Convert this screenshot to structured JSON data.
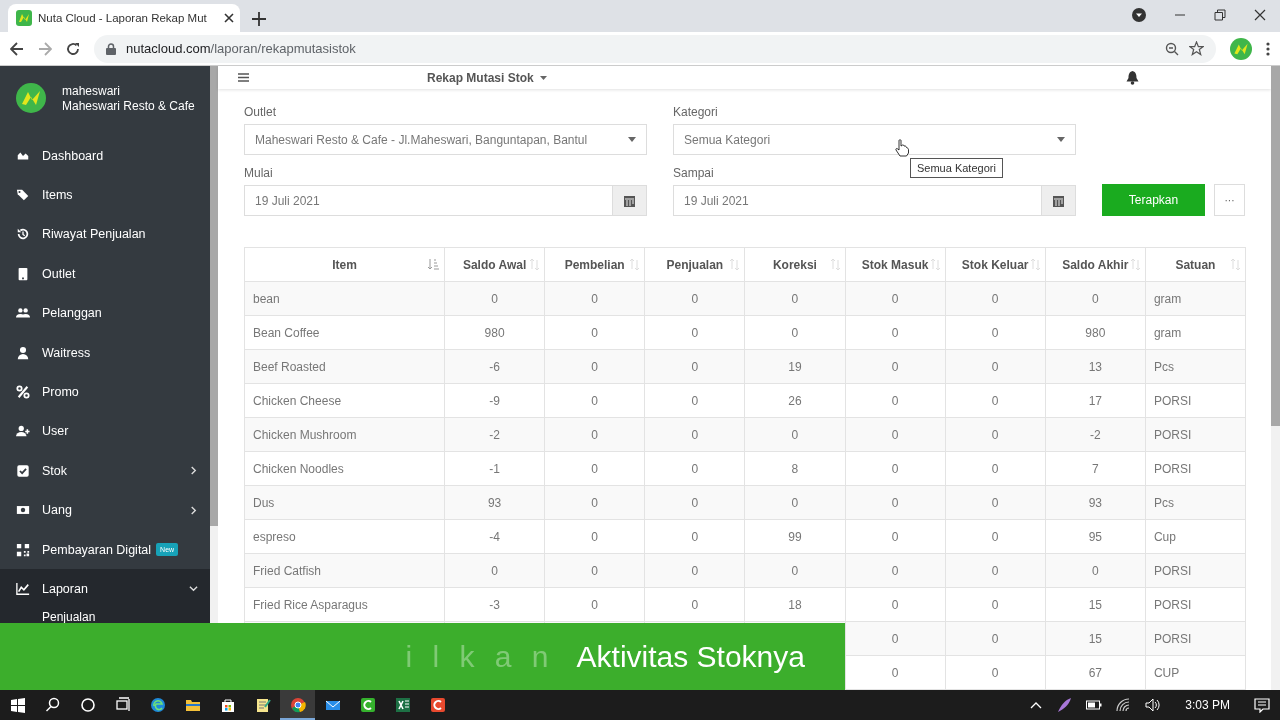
{
  "browser": {
    "tab_title": "Nuta Cloud - Laporan Rekap Mut",
    "url_domain": "nutacloud.com",
    "url_path": "/laporan/rekapmutasistok"
  },
  "sidebar": {
    "user": "maheswari",
    "store": "Maheswari Resto & Cafe",
    "items": [
      {
        "label": "Dashboard",
        "kind": "link",
        "expanded": false,
        "selected": false
      },
      {
        "label": "Items",
        "kind": "link",
        "expanded": false,
        "selected": false
      },
      {
        "label": "Riwayat Penjualan",
        "kind": "link",
        "expanded": false,
        "selected": false
      },
      {
        "label": "Outlet",
        "kind": "link",
        "expanded": false,
        "selected": false
      },
      {
        "label": "Pelanggan",
        "kind": "link",
        "expanded": false,
        "selected": false
      },
      {
        "label": "Waitress",
        "kind": "link",
        "expanded": false,
        "selected": false
      },
      {
        "label": "Promo",
        "kind": "link",
        "expanded": false,
        "selected": false
      },
      {
        "label": "User",
        "kind": "link",
        "expanded": false,
        "selected": false
      },
      {
        "label": "Stok",
        "kind": "group",
        "expanded": false,
        "selected": false
      },
      {
        "label": "Uang",
        "kind": "group",
        "expanded": false,
        "selected": false
      },
      {
        "label": "Pembayaran Digital",
        "badge": "New",
        "kind": "link",
        "expanded": false,
        "selected": false
      },
      {
        "label": "Laporan",
        "kind": "group",
        "expanded": true,
        "selected": true,
        "children": [
          {
            "label": "Penjualan"
          }
        ]
      }
    ]
  },
  "topbar": {
    "title": "Rekap Mutasi Stok"
  },
  "filters": {
    "outlet": {
      "label": "Outlet",
      "value": "Maheswari Resto & Cafe - Jl.Maheswari, Banguntapan, Bantul"
    },
    "kategori": {
      "label": "Kategori",
      "value": "Semua Kategori",
      "tooltip": "Semua Kategori"
    },
    "mulai": {
      "label": "Mulai",
      "value": "19 Juli 2021"
    },
    "sampai": {
      "label": "Sampai",
      "value": "19 Juli 2021"
    },
    "apply_button": "Terapkan",
    "more_button": "···"
  },
  "table": {
    "columns": [
      {
        "label": "Item",
        "sorted": true
      },
      {
        "label": "Saldo Awal",
        "sorted": false
      },
      {
        "label": "Pembelian",
        "sorted": false
      },
      {
        "label": "Penjualan",
        "sorted": false
      },
      {
        "label": "Koreksi",
        "sorted": false
      },
      {
        "label": "Stok Masuk",
        "sorted": false
      },
      {
        "label": "Stok Keluar",
        "sorted": false
      },
      {
        "label": "Saldo Akhir",
        "sorted": false
      },
      {
        "label": "Satuan",
        "sorted": false
      }
    ],
    "rows": [
      [
        "bean",
        "0",
        "0",
        "0",
        "0",
        "0",
        "0",
        "0",
        "gram"
      ],
      [
        "Bean Coffee",
        "980",
        "0",
        "0",
        "0",
        "0",
        "0",
        "980",
        "gram"
      ],
      [
        "Beef Roasted",
        "-6",
        "0",
        "0",
        "19",
        "0",
        "0",
        "13",
        "Pcs"
      ],
      [
        "Chicken Cheese",
        "-9",
        "0",
        "0",
        "26",
        "0",
        "0",
        "17",
        "PORSI"
      ],
      [
        "Chicken Mushroom",
        "-2",
        "0",
        "0",
        "0",
        "0",
        "0",
        "-2",
        "PORSI"
      ],
      [
        "Chicken Noodles",
        "-1",
        "0",
        "0",
        "8",
        "0",
        "0",
        "7",
        "PORSI"
      ],
      [
        "Dus",
        "93",
        "0",
        "0",
        "0",
        "0",
        "0",
        "93",
        "Pcs"
      ],
      [
        "espreso",
        "-4",
        "0",
        "0",
        "99",
        "0",
        "0",
        "95",
        "Cup"
      ],
      [
        "Fried Catfish",
        "0",
        "0",
        "0",
        "0",
        "0",
        "0",
        "0",
        "PORSI"
      ],
      [
        "Fried Rice Asparagus",
        "-3",
        "0",
        "0",
        "18",
        "0",
        "0",
        "15",
        "PORSI"
      ],
      [
        null,
        null,
        null,
        null,
        null,
        "0",
        "0",
        "15",
        "PORSI"
      ],
      [
        null,
        null,
        null,
        null,
        null,
        "0",
        "0",
        "67",
        "CUP"
      ]
    ]
  },
  "caption": {
    "faded": "i l k a n",
    "text": "Aktivitas Stoknya"
  },
  "taskbar": {
    "time": "3:03 PM"
  }
}
